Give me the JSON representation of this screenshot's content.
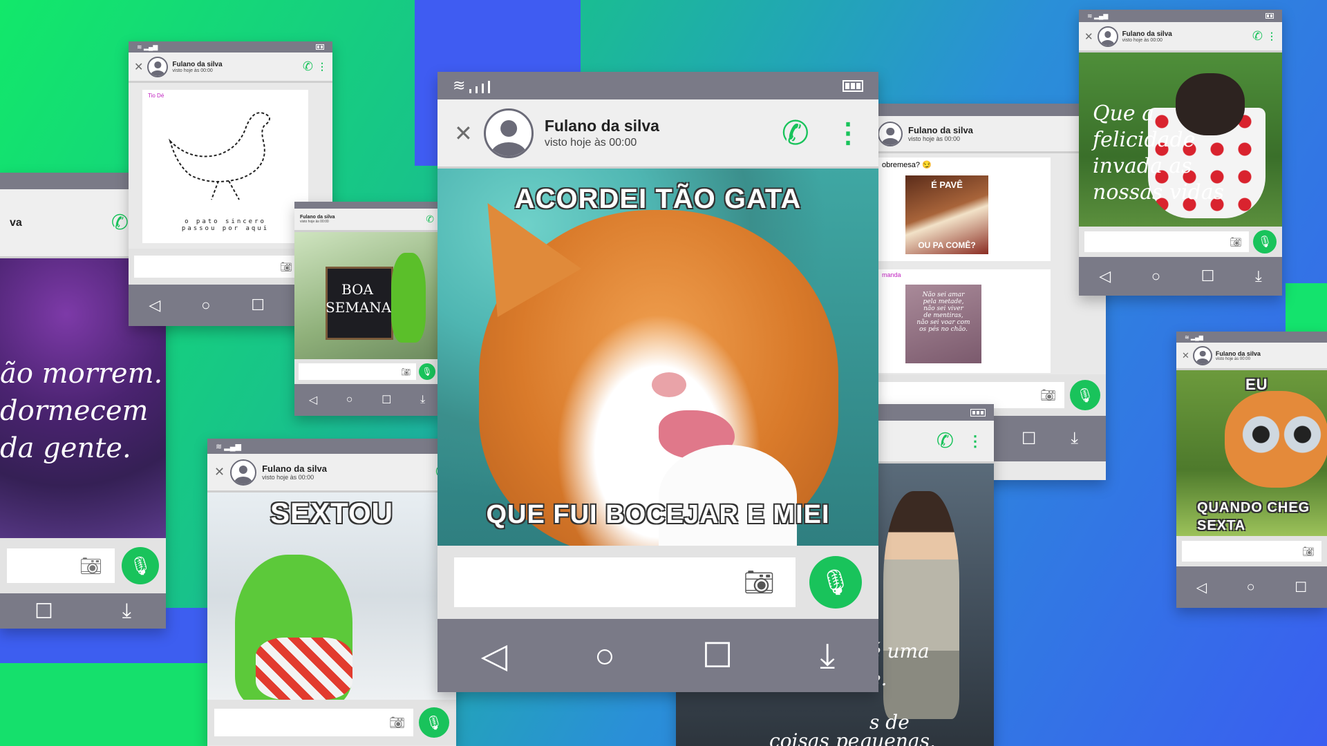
{
  "contact": {
    "name": "Fulano da silva",
    "seen": "visto hoje às 00:00"
  },
  "icons": [
    "close-icon",
    "avatar-icon",
    "phone-call-icon",
    "more-vert-icon",
    "camera-icon",
    "mic-icon",
    "wifi-icon",
    "signal-icon",
    "battery-icon",
    "back-icon",
    "home-icon",
    "recents-icon",
    "download-icon"
  ],
  "colors": {
    "accent": "#19c35b",
    "statusbar": "#7a7a87",
    "bg_green": "#12e86a",
    "bg_blue": "#3a5ef0"
  },
  "main_meme": {
    "top": "ACORDEI TÃO GATA",
    "bottom": "QUE FUI BOCEJAR E MIEI"
  },
  "kermit_meme": {
    "top": "SEXTOU"
  },
  "duck_card": {
    "sender": "Tio Dé",
    "caption": "o pato sincero\npassou por aqui"
  },
  "boa_semana": {
    "text": "BOA\nSEMANA"
  },
  "flower_quote": {
    "text": "ão morrem.\ndormecem\nda gente."
  },
  "dessert_chat": {
    "msg": "obremesa? 😏",
    "img_top": "É PAVÊ",
    "img_bottom": "OU PA COMÊ?",
    "sender2": "manda",
    "quote": "Não sei amar\npela metade,\nnão sei viver\nde mentiras,\nnão sei voar com\nos pés no chão."
  },
  "puppy_quote": {
    "text": "Que a\nfelicidade\ninvada as\nnossas vidas"
  },
  "cat_friday": {
    "top": "EU",
    "bottom": "QUANDO CHEG\nSEXTA"
  },
  "boy_quote": {
    "line1": "é uma",
    "line2": "e.",
    "line3": "s de",
    "line4": "coisas pequenas."
  }
}
